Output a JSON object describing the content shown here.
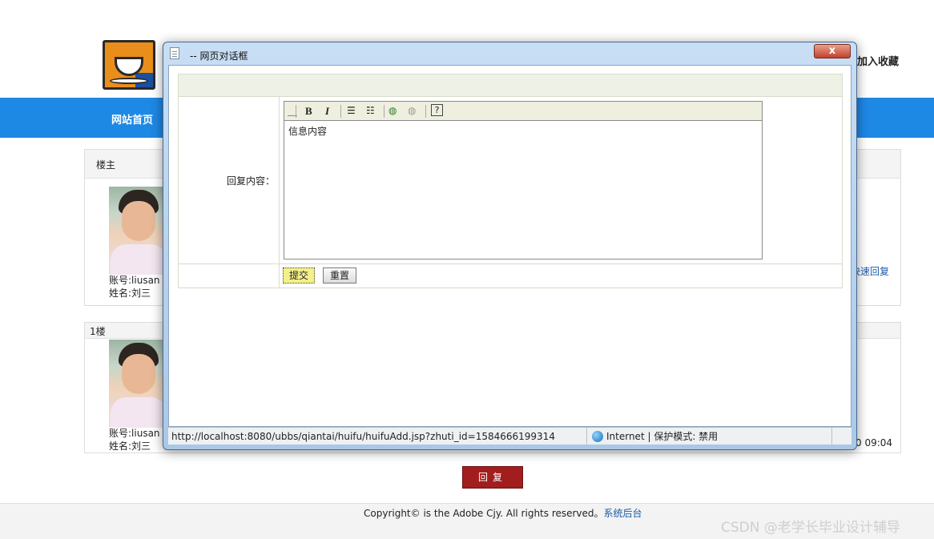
{
  "header": {
    "favorite_text": "加入收藏",
    "nav_home": "网站首页"
  },
  "posts": [
    {
      "floor": "楼主",
      "account_label": "账号:",
      "account": "liusan",
      "name_label": "姓名:",
      "name": "刘三"
    },
    {
      "floor": "1楼",
      "account_label": "账号:",
      "account": "liusan",
      "name_label": "姓名:",
      "name": "刘三",
      "time": "0 09:04"
    }
  ],
  "quick_reply": "快速回复",
  "reply_button": "回复",
  "footer": {
    "copyright": "Copyright© is the Adobe Cjy. All rights reserved。",
    "admin_link": "系统后台"
  },
  "watermark": "CSDN @老学长毕业设计辅导",
  "dialog": {
    "title": "-- 网页对话框",
    "close_label": "x",
    "form": {
      "label": "回复内容：",
      "editor_text": "信息内容",
      "toolbar": {
        "bold": "B",
        "italic": "I",
        "help": "?"
      },
      "submit": "提交",
      "reset": "重置"
    },
    "status": {
      "url": "http://localhost:8080/ubbs/qiantai/huifu/huifuAdd.jsp?zhuti_id=1584666199314",
      "zone": "Internet | 保护模式: 禁用"
    }
  }
}
